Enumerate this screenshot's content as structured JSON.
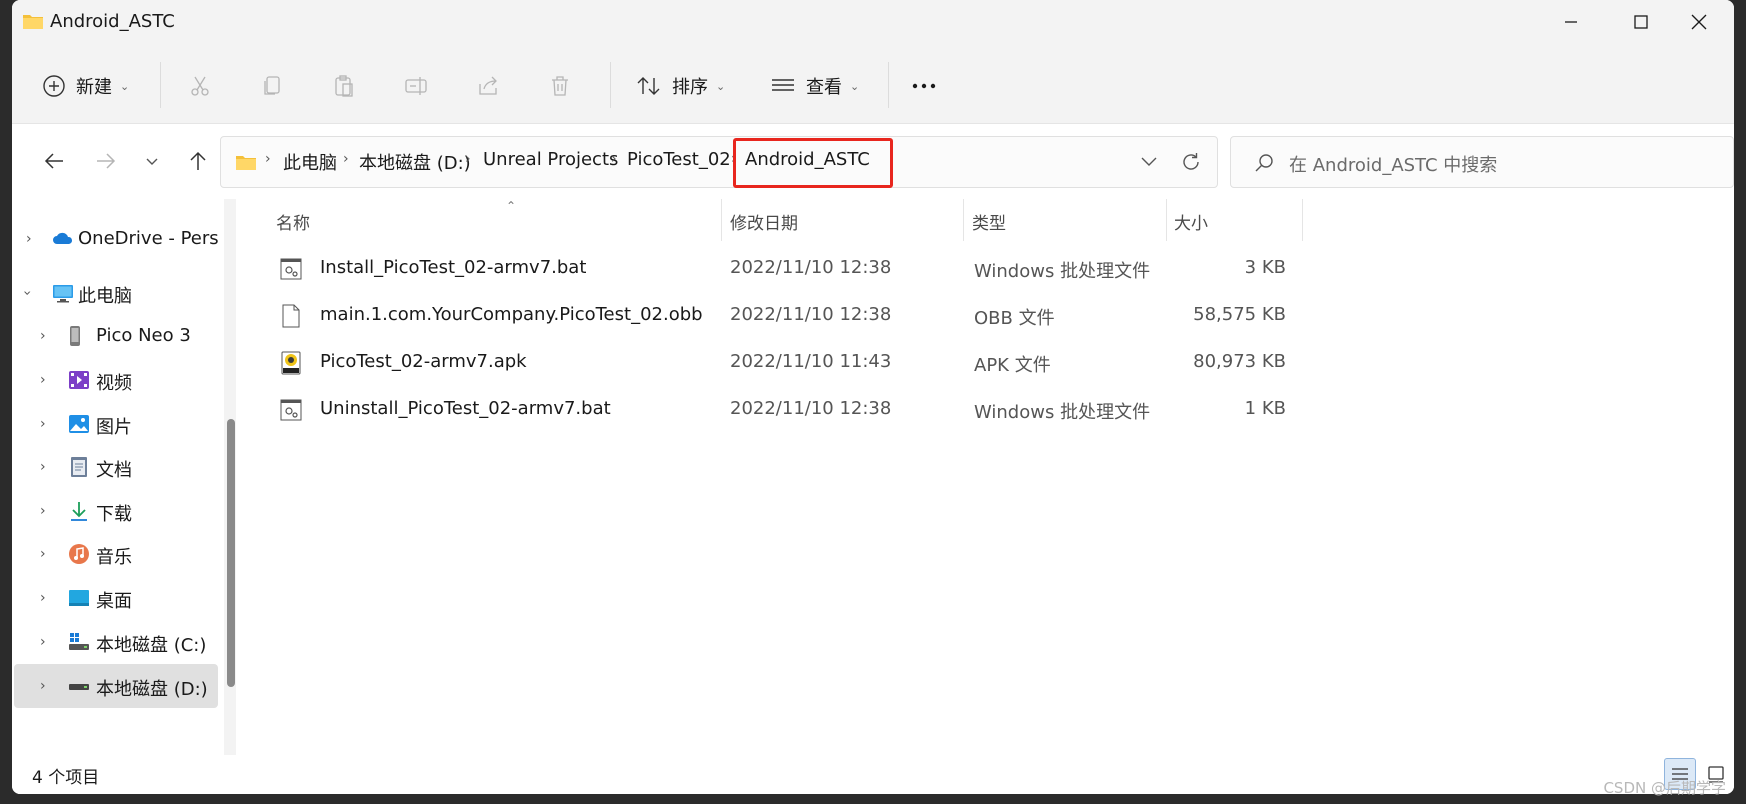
{
  "window": {
    "title": "Android_ASTC"
  },
  "toolbar": {
    "new_label": "新建",
    "sort_label": "排序",
    "view_label": "查看"
  },
  "address": {
    "crumbs": [
      "此电脑",
      "本地磁盘 (D:)",
      "Unreal Projects",
      "PicoTest_02",
      "Android_ASTC"
    ]
  },
  "search": {
    "placeholder": "在 Android_ASTC 中搜索"
  },
  "sidebar": {
    "items": [
      {
        "label": "OneDrive - Pers",
        "icon": "cloud-icon",
        "expanded": false,
        "indent": 0
      },
      {
        "label": "此电脑",
        "icon": "computer-icon",
        "expanded": true,
        "indent": 0
      },
      {
        "label": "Pico Neo 3",
        "icon": "device-icon",
        "expanded": false,
        "indent": 1
      },
      {
        "label": "视频",
        "icon": "video-icon",
        "expanded": false,
        "indent": 1
      },
      {
        "label": "图片",
        "icon": "pictures-icon",
        "expanded": false,
        "indent": 1
      },
      {
        "label": "文档",
        "icon": "documents-icon",
        "expanded": false,
        "indent": 1
      },
      {
        "label": "下载",
        "icon": "download-icon",
        "expanded": false,
        "indent": 1
      },
      {
        "label": "音乐",
        "icon": "music-icon",
        "expanded": false,
        "indent": 1
      },
      {
        "label": "桌面",
        "icon": "desktop-icon",
        "expanded": false,
        "indent": 1
      },
      {
        "label": "本地磁盘 (C:)",
        "icon": "drive-c-icon",
        "expanded": false,
        "indent": 1
      },
      {
        "label": "本地磁盘 (D:)",
        "icon": "drive-d-icon",
        "expanded": false,
        "indent": 1,
        "selected": true
      }
    ]
  },
  "columns": {
    "name": "名称",
    "date": "修改日期",
    "type": "类型",
    "size": "大小"
  },
  "files": [
    {
      "name": "Install_PicoTest_02-armv7.bat",
      "date": "2022/11/10 12:38",
      "type": "Windows 批处理文件",
      "size": "3 KB",
      "icon": "bat-file-icon"
    },
    {
      "name": "main.1.com.YourCompany.PicoTest_02.obb",
      "date": "2022/11/10 12:38",
      "type": "OBB 文件",
      "size": "58,575 KB",
      "icon": "generic-file-icon"
    },
    {
      "name": "PicoTest_02-armv7.apk",
      "date": "2022/11/10 11:43",
      "type": "APK 文件",
      "size": "80,973 KB",
      "icon": "apk-file-icon"
    },
    {
      "name": "Uninstall_PicoTest_02-armv7.bat",
      "date": "2022/11/10 12:38",
      "type": "Windows 批处理文件",
      "size": "1 KB",
      "icon": "bat-file-icon"
    }
  ],
  "status": {
    "item_count": "4 个项目"
  },
  "watermark": "CSDN @后期学字"
}
